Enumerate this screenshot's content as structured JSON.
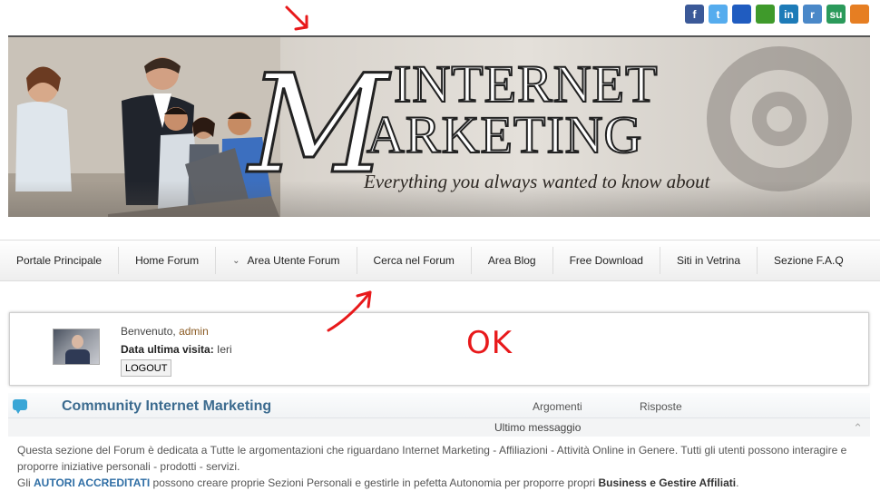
{
  "social_icons": [
    {
      "name": "facebook-icon",
      "glyph": "f",
      "color": "#3b5998"
    },
    {
      "name": "twitter-icon",
      "glyph": "t",
      "color": "#55acee"
    },
    {
      "name": "delicious-icon",
      "glyph": "",
      "color": "#205cc0"
    },
    {
      "name": "google-bookmarks-icon",
      "glyph": "",
      "color": "#3f9a2b"
    },
    {
      "name": "linkedin-icon",
      "glyph": "in",
      "color": "#1d7bb8"
    },
    {
      "name": "reddit-icon",
      "glyph": "r",
      "color": "#4a88c8"
    },
    {
      "name": "stumbleupon-icon",
      "glyph": "su",
      "color": "#2b9a5b"
    },
    {
      "name": "rss-icon",
      "glyph": "",
      "color": "#e67e22"
    }
  ],
  "banner": {
    "title_line1": "NTERNET",
    "title_line2": "ARKETING",
    "big_letter": "M",
    "small_i": "I",
    "tagline": "Everything you always wanted to know about"
  },
  "nav": {
    "items": [
      {
        "label": "Portale Principale",
        "has_chevron": false
      },
      {
        "label": "Home Forum",
        "has_chevron": false
      },
      {
        "label": "Area Utente Forum",
        "has_chevron": true
      },
      {
        "label": "Cerca nel Forum",
        "has_chevron": false
      },
      {
        "label": "Area Blog",
        "has_chevron": false
      },
      {
        "label": "Free Download",
        "has_chevron": false
      },
      {
        "label": "Siti in Vetrina",
        "has_chevron": false
      },
      {
        "label": "Sezione F.A.Q",
        "has_chevron": false
      }
    ]
  },
  "user_panel": {
    "welcome_prefix": "Benvenuto, ",
    "username": "admin",
    "last_visit_label": "Data ultima visita:",
    "last_visit_value": " Ieri",
    "logout_label": "LOGOUT"
  },
  "forum": {
    "title": "Community Internet Marketing",
    "col_topics": "Argomenti",
    "col_replies": "Risposte",
    "last_message": "Ultimo messaggio",
    "desc_line1": "Questa sezione del Forum è dedicata a Tutte le argomentazioni che riguardano Internet Marketing - Affiliazioni - Attività Online in Genere. Tutti gli utenti possono interagire e proporre iniziative personali - prodotti - servizi.",
    "desc_line2_pre": "Gli ",
    "desc_line2_link": "AUTORI ACCREDITATI",
    "desc_line2_mid": " possono creare proprie Sezioni Personali e gestirle in pefetta Autonomia per proporre propri ",
    "desc_line2_bold": "Business e Gestire Affiliati",
    "desc_line2_end": "."
  },
  "annotations": {
    "ok_text": "OK",
    "color": "#e8191b"
  }
}
